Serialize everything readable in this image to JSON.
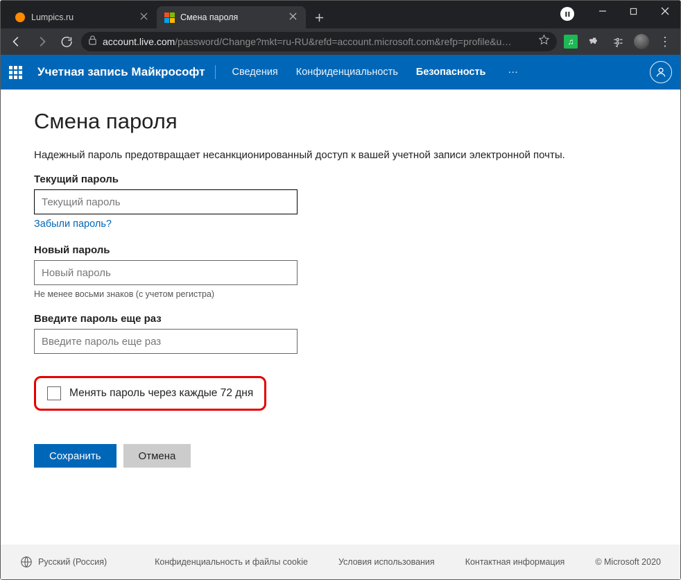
{
  "browser": {
    "tabs": [
      {
        "title": "Lumpics.ru",
        "active": false
      },
      {
        "title": "Смена пароля",
        "active": true
      }
    ],
    "url_host": "account.live.com",
    "url_path": "/password/Change?mkt=ru-RU&refd=account.microsoft.com&refp=profile&u…"
  },
  "header": {
    "brand": "Учетная запись Майкрософт",
    "nav": {
      "info": "Сведения",
      "privacy": "Конфиденциальность",
      "security": "Безопасность"
    }
  },
  "page": {
    "title": "Смена пароля",
    "description": "Надежный пароль предотвращает несанкционированный доступ к вашей учетной записи электронной почты.",
    "current_label": "Текущий пароль",
    "current_placeholder": "Текущий пароль",
    "forgot": "Забыли пароль?",
    "new_label": "Новый пароль",
    "new_placeholder": "Новый пароль",
    "hint": "Не менее восьми знаков (с учетом регистра)",
    "repeat_label": "Введите пароль еще раз",
    "repeat_placeholder": "Введите пароль еще раз",
    "checkbox_label": "Менять пароль через каждые 72 дня",
    "save": "Сохранить",
    "cancel": "Отмена"
  },
  "footer": {
    "lang": "Русский (Россия)",
    "privacy": "Конфиденциальность и файлы cookie",
    "terms": "Условия использования",
    "contact": "Контактная информация",
    "copyright": "© Microsoft 2020"
  }
}
